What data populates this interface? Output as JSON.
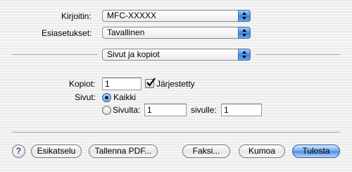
{
  "printer": {
    "label": "Kirjoitin:",
    "value": "MFC-XXXXX"
  },
  "presets": {
    "label": "Esiasetukset:",
    "value": "Tavallinen"
  },
  "panel": {
    "value": "Sivut ja kopiot"
  },
  "copies": {
    "label": "Kopiot:",
    "value": "1",
    "collated_label": "Järjestetty",
    "collated": true
  },
  "pages": {
    "label": "Sivut:",
    "all_label": "Kaikki",
    "all_selected": true,
    "from_label": "Sivulta:",
    "from_value": "1",
    "to_label": "sivulle:",
    "to_value": "1"
  },
  "buttons": {
    "help": "?",
    "preview": "Esikatselu",
    "save_pdf": "Tallenna PDF...",
    "fax": "Faksi...",
    "cancel": "Kumoa",
    "print": "Tulosta"
  },
  "colors": {
    "accent": "#4a8ce6",
    "background": "#ececec"
  },
  "icons": {
    "popup_arrows": "updown-arrows-icon",
    "help": "help-icon",
    "check": "checkmark-icon"
  }
}
